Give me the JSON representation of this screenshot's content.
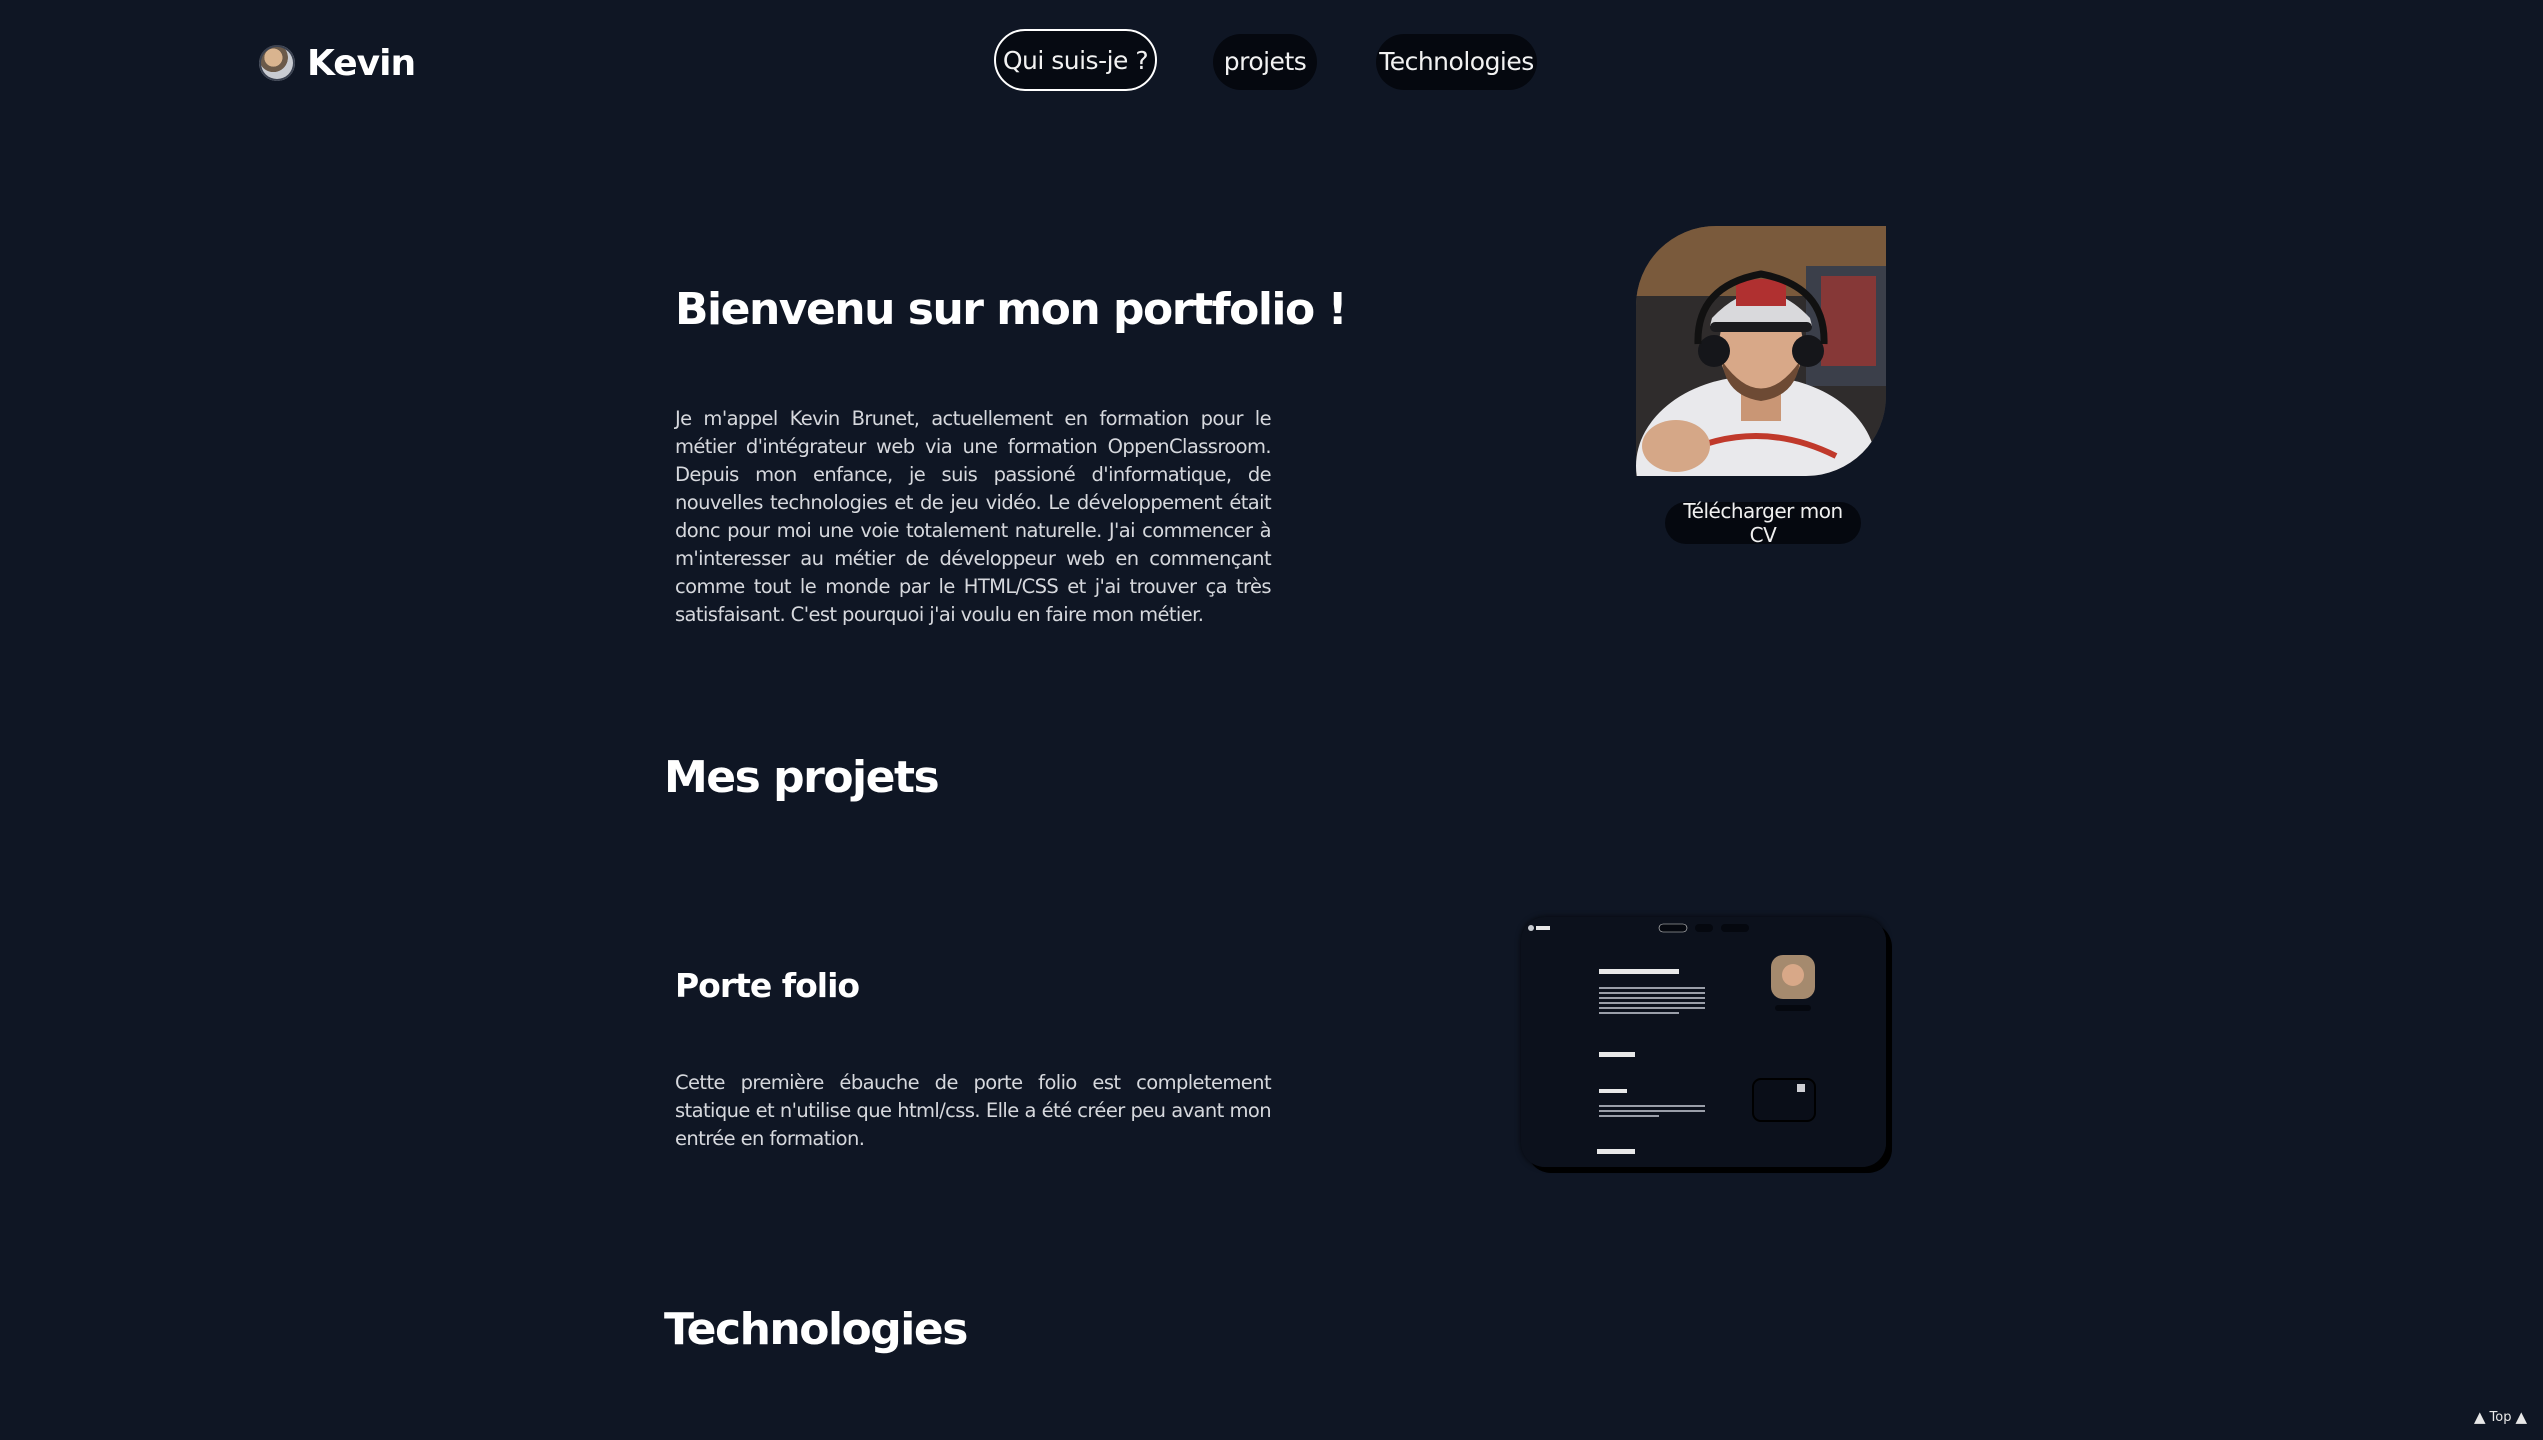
{
  "header": {
    "brand_name": "Kevin",
    "nav": [
      {
        "label": "Qui suis-je ?",
        "active": true
      },
      {
        "label": "projets",
        "active": false
      },
      {
        "label": "Technologies",
        "active": false
      }
    ]
  },
  "intro": {
    "title": "Bienvenu sur mon portfolio !",
    "text": "Je m'appel Kevin Brunet, actuellement en formation pour le métier d'intégrateur web via une formation OppenClassroom. Depuis mon enfance, je suis passioné d'informatique, de nouvelles technologies et de jeu vidéo. Le développement était donc pour moi une voie totalement naturelle. J'ai commencer à m'interesser au métier de développeur web en commençant comme tout le monde par le HTML/CSS et j'ai trouver ça très satisfaisant. C'est pourquoi j'ai voulu en faire mon métier.",
    "cv_button": "Télécharger mon CV"
  },
  "projects": {
    "title": "Mes projets",
    "items": [
      {
        "title": "Porte folio",
        "text": "Cette première ébauche de porte folio est completement statique et n'utilise que html/css. Elle a été créer peu avant mon entrée en formation."
      }
    ]
  },
  "technologies": {
    "title": "Technologies"
  },
  "footer": {
    "top_label": "Top"
  },
  "colors": {
    "background": "#0f1624",
    "button_bg": "#05080f",
    "text": "#d6d8dd"
  }
}
